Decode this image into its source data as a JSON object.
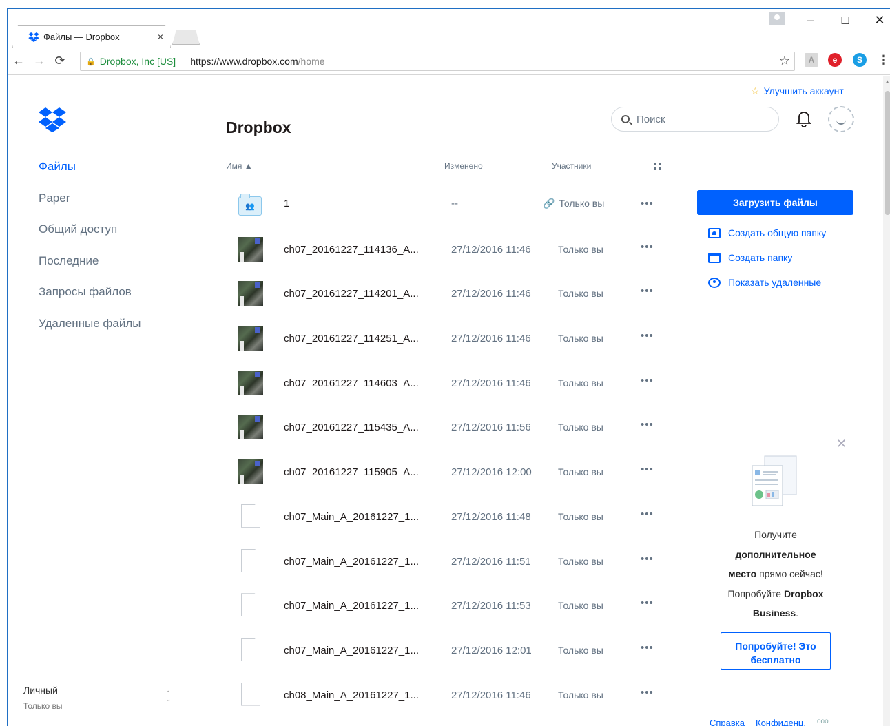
{
  "browser": {
    "tab_title": "Файлы — Dropbox",
    "tab_close": "×",
    "address": {
      "secure_label": "Dropbox, Inc [US]",
      "url_host": "https://www.dropbox.com",
      "url_path": "/home"
    },
    "window_controls": {
      "minimize": "–",
      "maximize": "☐",
      "close": "✕"
    }
  },
  "app": {
    "title": "Dropbox",
    "upgrade_label": "Улучшить аккаунт",
    "search_placeholder": "Поиск",
    "colors": {
      "accent": "#0061fe",
      "muted": "#637282"
    }
  },
  "sidebar": {
    "items": [
      {
        "label": "Файлы",
        "active": true
      },
      {
        "label": "Paper"
      },
      {
        "label": "Общий доступ"
      },
      {
        "label": "Последние"
      },
      {
        "label": "Запросы файлов"
      },
      {
        "label": "Удаленные файлы"
      }
    ],
    "account": {
      "name": "Личный",
      "sub": "Только вы"
    }
  },
  "table": {
    "headers": {
      "name": "Имя ▲",
      "modified": "Изменено",
      "members": "Участники"
    },
    "rows": [
      {
        "icon": "shared-folder-icon",
        "name": "1",
        "modified": "--",
        "members": "Только вы",
        "more": "•••"
      },
      {
        "icon": "image-thumbnail",
        "name": "ch07_20161227_114136_A...",
        "modified": "27/12/2016 11:46",
        "members": "Только вы",
        "more": "•••"
      },
      {
        "icon": "image-thumbnail",
        "name": "ch07_20161227_114201_A...",
        "modified": "27/12/2016 11:46",
        "members": "Только вы",
        "more": "•••"
      },
      {
        "icon": "image-thumbnail",
        "name": "ch07_20161227_114251_A...",
        "modified": "27/12/2016 11:46",
        "members": "Только вы",
        "more": "•••"
      },
      {
        "icon": "image-thumbnail",
        "name": "ch07_20161227_114603_A...",
        "modified": "27/12/2016 11:46",
        "members": "Только вы",
        "more": "•••"
      },
      {
        "icon": "image-thumbnail",
        "name": "ch07_20161227_115435_A...",
        "modified": "27/12/2016 11:56",
        "members": "Только вы",
        "more": "•••"
      },
      {
        "icon": "image-thumbnail",
        "name": "ch07_20161227_115905_A...",
        "modified": "27/12/2016 12:00",
        "members": "Только вы",
        "more": "•••"
      },
      {
        "icon": "file-icon",
        "name": "ch07_Main_A_20161227_1...",
        "modified": "27/12/2016 11:48",
        "members": "Только вы",
        "more": "•••"
      },
      {
        "icon": "file-icon",
        "name": "ch07_Main_A_20161227_1...",
        "modified": "27/12/2016 11:51",
        "members": "Только вы",
        "more": "•••"
      },
      {
        "icon": "file-icon",
        "name": "ch07_Main_A_20161227_1...",
        "modified": "27/12/2016 11:53",
        "members": "Только вы",
        "more": "•••"
      },
      {
        "icon": "file-icon",
        "name": "ch07_Main_A_20161227_1...",
        "modified": "27/12/2016 12:01",
        "members": "Только вы",
        "more": "•••"
      },
      {
        "icon": "file-icon",
        "name": "ch08_Main_A_20161227_1...",
        "modified": "27/12/2016 11:46",
        "members": "Только вы",
        "more": "•••"
      }
    ]
  },
  "actions": {
    "upload": "Загрузить файлы",
    "new_shared_folder": "Создать общую папку",
    "new_folder": "Создать папку",
    "show_deleted": "Показать удаленные"
  },
  "promo": {
    "line1": "Получите",
    "bold1": "дополнительное",
    "bold2": "место",
    "line2": " прямо сейчас!",
    "line3": "Попробуйте ",
    "bold3": "Dropbox Business",
    "line4": ".",
    "button": "Попробуйте! Это бесплатно",
    "close": "✕"
  },
  "footer": {
    "help": "Справка",
    "privacy": "Конфиденц.",
    "more": "ooo"
  }
}
